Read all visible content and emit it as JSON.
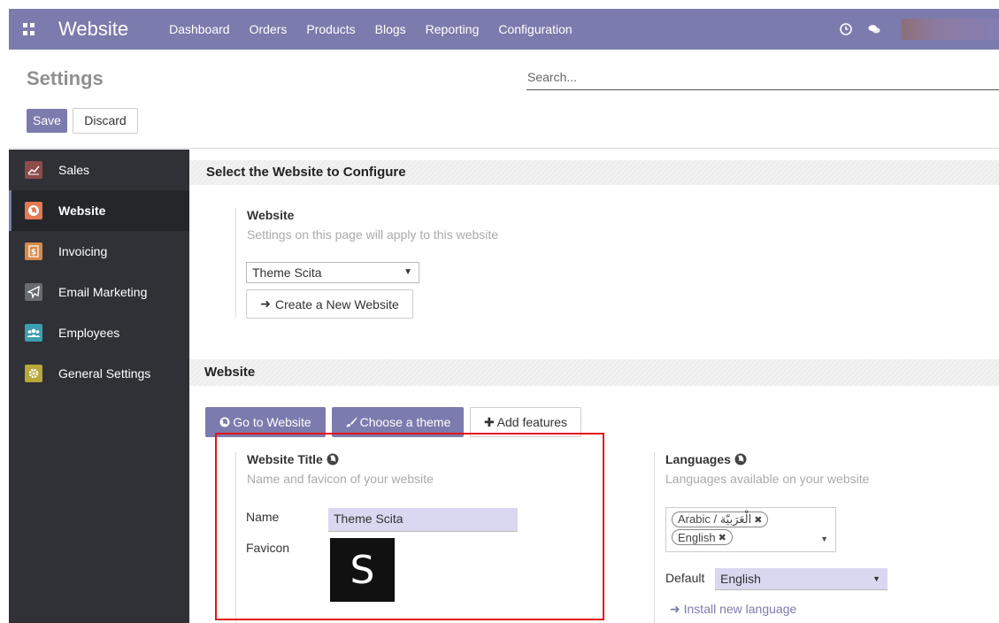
{
  "app": {
    "brand": "Website",
    "menu": [
      "Dashboard",
      "Orders",
      "Products",
      "Blogs",
      "Reporting",
      "Configuration"
    ]
  },
  "control": {
    "title": "Settings",
    "search_placeholder": "Search...",
    "save_label": "Save",
    "discard_label": "Discard"
  },
  "sidebar": {
    "items": [
      {
        "label": "Sales",
        "icon": "sales-chart-icon",
        "color": "#8f4a4a"
      },
      {
        "label": "Website",
        "icon": "globe-icon",
        "color": "#e27a52"
      },
      {
        "label": "Invoicing",
        "icon": "invoice-dollar-icon",
        "color": "#d58a4b"
      },
      {
        "label": "Email Marketing",
        "icon": "paper-plane-icon",
        "color": "#666b72"
      },
      {
        "label": "Employees",
        "icon": "employees-group-icon",
        "color": "#3c9fb1"
      },
      {
        "label": "General Settings",
        "icon": "gear-icon",
        "color": "#b8a73a"
      }
    ]
  },
  "configure": {
    "section_title": "Select the Website to Configure",
    "field_label": "Website",
    "field_help": "Settings on this page will apply to this website",
    "selected_website": "Theme Scita",
    "create_button": "Create a New Website"
  },
  "website": {
    "section_title": "Website",
    "go_button": "Go to Website",
    "theme_button": "Choose a theme",
    "features_button": "Add features",
    "title_block": {
      "title": "Website Title",
      "help": "Name and favicon of your website",
      "name_label": "Name",
      "name_value": "Theme Scita",
      "favicon_label": "Favicon",
      "favicon_letter": "S"
    },
    "languages_block": {
      "title": "Languages",
      "help": "Languages available on your website",
      "tags": [
        "Arabic / الْعَرَبيّة",
        "English"
      ],
      "default_label": "Default",
      "default_value": "English",
      "install_link": "Install new language"
    }
  },
  "colors": {
    "accent": "#7c7bad",
    "sidebar_bg": "#2f3136",
    "highlight": "#e3131b"
  }
}
